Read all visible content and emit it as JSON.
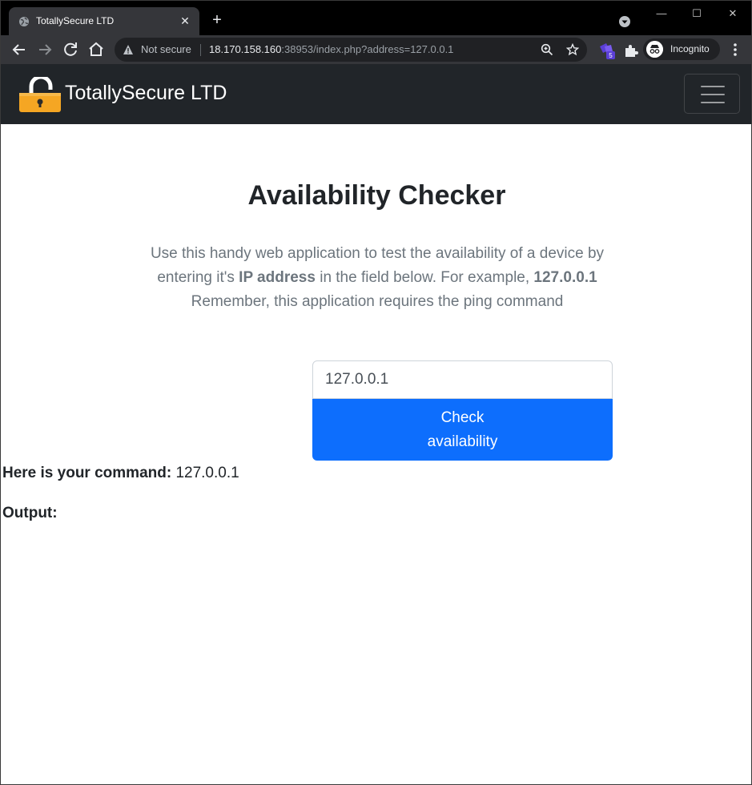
{
  "browser": {
    "tab_title": "TotallySecure LTD",
    "new_tab_symbol": "+",
    "close_symbol": "✕",
    "security_label": "Not secure",
    "url_host": "18.170.158.160",
    "url_rest": ":38953/index.php?address=127.0.0.1",
    "extension_badge": "5",
    "profile_label": "Incognito",
    "window_controls": {
      "minimize": "—",
      "maximize": "☐",
      "close": "✕"
    },
    "icons": [
      "globe-icon",
      "back-arrow-icon",
      "forward-arrow-icon",
      "reload-icon",
      "home-icon",
      "warning-icon",
      "zoom-icon",
      "star-icon",
      "extension-icon",
      "puzzle-icon",
      "incognito-icon",
      "menu-dots-icon",
      "tab-search-icon"
    ]
  },
  "navbar": {
    "brand": "TotallySecure LTD",
    "logo_icon": "padlock-icon",
    "toggle_icon": "hamburger-icon",
    "colors": {
      "background": "#212529",
      "logo": "#f5a623"
    }
  },
  "main": {
    "heading": "Availability Checker",
    "lead_part1": "Use this handy web application to test the availability of a device by entering it's ",
    "lead_bold1": "IP address",
    "lead_part2": " in the field below. For example, ",
    "lead_bold2": "127.0.0.1",
    "lead_part3": " Remember, this application requires the ping command",
    "input_value": "127.0.0.1",
    "button_label": "Check availability",
    "button_color": "#0d6efd",
    "command_label": "Here is your command:",
    "command_value": "127.0.0.1",
    "output_label": "Output:"
  }
}
